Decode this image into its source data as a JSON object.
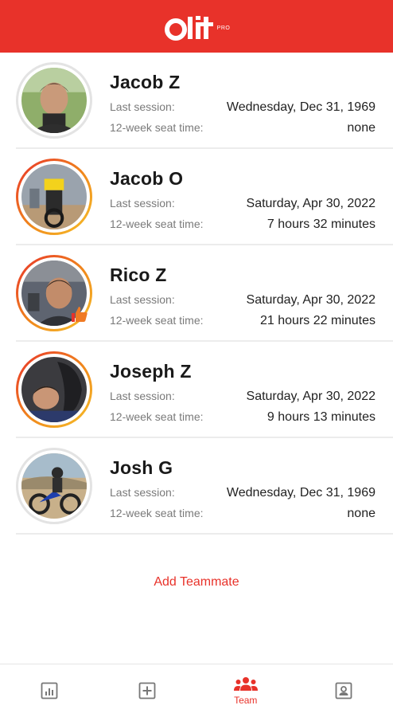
{
  "header": {
    "logo_text": "Olit",
    "logo_badge": "PRO",
    "brand_color": "#e8322a"
  },
  "team": {
    "last_session_label": "Last session:",
    "seat_time_label": "12-week seat time:",
    "members": [
      {
        "name": "Jacob Z",
        "last_session": "Wednesday, Dec 31, 1969",
        "seat_time": "none",
        "ring": "plain"
      },
      {
        "name": "Jacob O",
        "last_session": "Saturday, Apr 30, 2022",
        "seat_time": "7 hours 32 minutes",
        "ring": "active"
      },
      {
        "name": "Rico Z",
        "last_session": "Saturday, Apr 30, 2022",
        "seat_time": "21 hours 22 minutes",
        "ring": "active",
        "badge": "thumbs-up-icon"
      },
      {
        "name": "Joseph Z",
        "last_session": "Saturday, Apr 30, 2022",
        "seat_time": "9 hours 13 minutes",
        "ring": "active"
      },
      {
        "name": "Josh G",
        "last_session": "Wednesday, Dec 31, 1969",
        "seat_time": "none",
        "ring": "plain"
      }
    ]
  },
  "actions": {
    "add_teammate": "Add Teammate"
  },
  "nav": {
    "items": [
      {
        "icon": "stats-icon",
        "label": ""
      },
      {
        "icon": "add-session-icon",
        "label": ""
      },
      {
        "icon": "team-icon",
        "label": "Team",
        "active": true
      },
      {
        "icon": "profile-icon",
        "label": ""
      }
    ]
  }
}
